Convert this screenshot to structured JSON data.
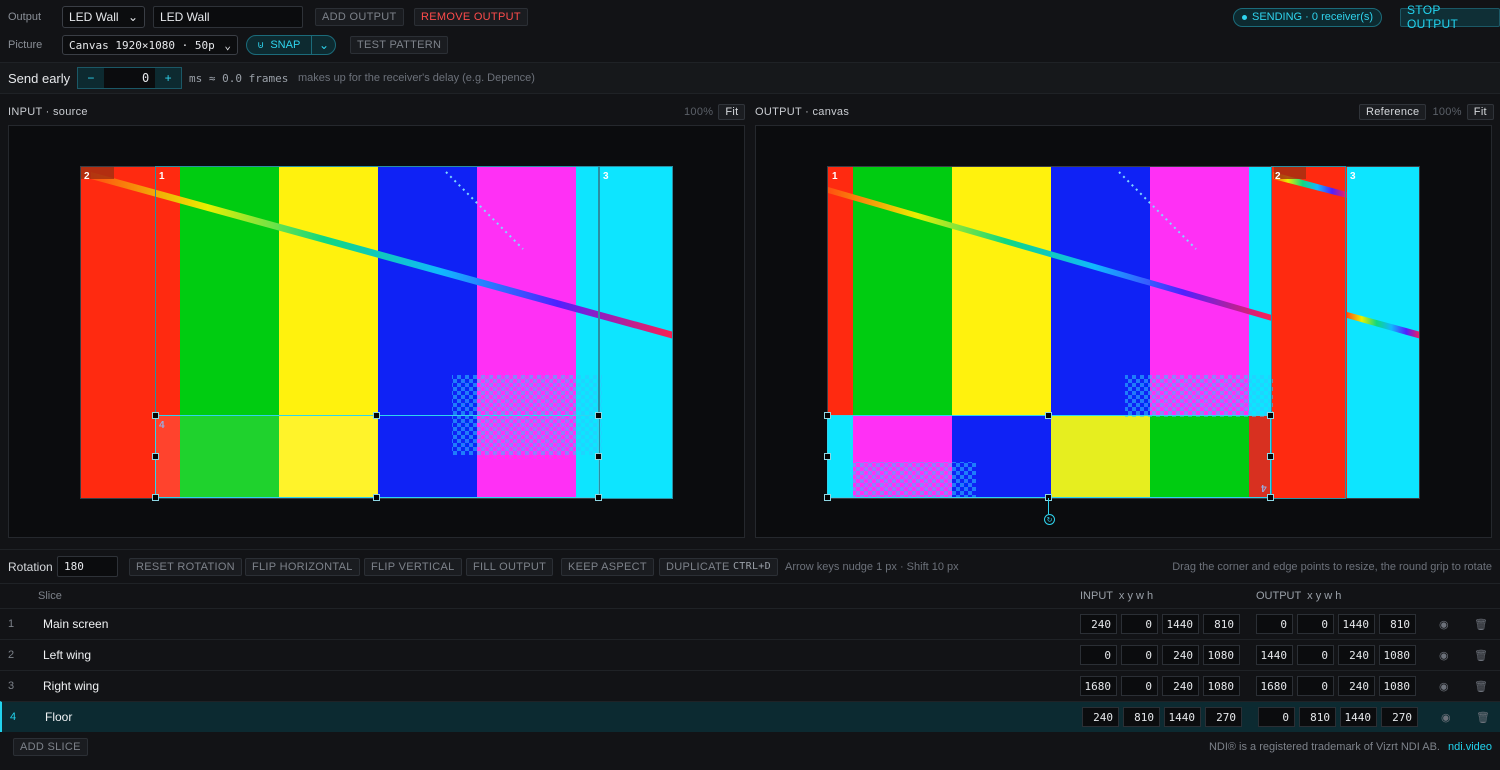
{
  "header": {
    "output_label": "Output",
    "output_select": "LED Wall",
    "output_name": "LED Wall",
    "add_output": "ADD OUTPUT",
    "remove_output": "REMOVE OUTPUT",
    "status": "SENDING · 0 receiver(s)",
    "stop_output": "STOP OUTPUT",
    "picture_label": "Picture",
    "picture_select": "Canvas 1920×1080 · 50p",
    "snap": "SNAP",
    "test_pattern": "TEST PATTERN"
  },
  "send_early": {
    "label": "Send early",
    "minus": "−",
    "value": "0",
    "plus": "+",
    "unit": "ms ≈ 0.0 frames",
    "hint": "makes up for the receiver's delay (e.g. Depence)"
  },
  "input_pane": {
    "title": "INPUT · source",
    "zoom": "100%",
    "fit": "Fit"
  },
  "output_pane": {
    "title": "OUTPUT · canvas",
    "reference": "Reference",
    "zoom": "100%",
    "fit": "Fit"
  },
  "toolbar": {
    "rotation_label": "Rotation",
    "rotation_value": "180",
    "reset_rotation": "RESET ROTATION",
    "flip_h": "FLIP HORIZONTAL",
    "flip_v": "FLIP VERTICAL",
    "fill_output": "FILL OUTPUT",
    "keep_aspect": "KEEP ASPECT",
    "duplicate": "DUPLICATE",
    "duplicate_key": "CTRL+D",
    "nudge_hint": "Arrow keys nudge 1 px · Shift 10 px",
    "drag_hint": "Drag the corner and edge points to resize, the round grip to rotate"
  },
  "table": {
    "col_slice": "Slice",
    "col_input": "INPUT  x y w h",
    "col_output": "OUTPUT  x y w h",
    "rows": [
      {
        "idx": "1",
        "name": "Main screen",
        "in": [
          "240",
          "0",
          "1440",
          "810"
        ],
        "out": [
          "0",
          "0",
          "1440",
          "810"
        ]
      },
      {
        "idx": "2",
        "name": "Left wing",
        "in": [
          "0",
          "0",
          "240",
          "1080"
        ],
        "out": [
          "1440",
          "0",
          "240",
          "1080"
        ]
      },
      {
        "idx": "3",
        "name": "Right wing",
        "in": [
          "1680",
          "0",
          "240",
          "1080"
        ],
        "out": [
          "1680",
          "0",
          "240",
          "1080"
        ]
      },
      {
        "idx": "4",
        "name": "Floor",
        "in": [
          "240",
          "810",
          "1440",
          "270"
        ],
        "out": [
          "0",
          "810",
          "1440",
          "270"
        ]
      }
    ]
  },
  "footer": {
    "add_slice": "ADD SLICE",
    "trademark": "NDI® is a registered trademark of Vizrt NDI AB.",
    "link": "ndi.video"
  },
  "slice_labels": {
    "s1": "1",
    "s2": "2",
    "s3": "3",
    "s4": "4"
  },
  "colors": {
    "accent": "#22d3ee",
    "danger": "#ff4b4b",
    "red": "#ff2a10",
    "green": "#00cc11",
    "yellow": "#fff20d",
    "blue": "#0f22f5",
    "magenta": "#ff30f5",
    "cyan": "#0de5ff"
  }
}
